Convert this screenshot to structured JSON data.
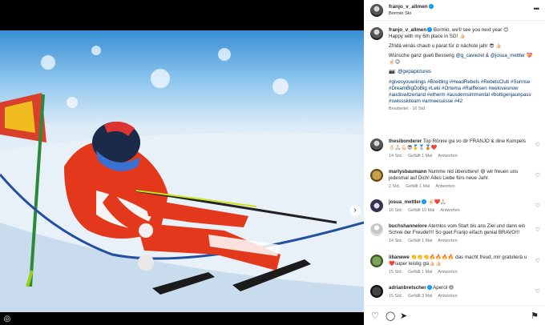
{
  "post": {
    "username": "franjo_v_allmen",
    "location": "Bormio Ski",
    "caption_lines": [
      [
        "Bormio, we'll see you next year ",
        "😊"
      ],
      [
        "Happy with my 6th place in SG! ",
        "👍🏻"
      ]
    ],
    "caption_swiss": "Zfridä winäs chaub u parat für iz nächste jahr 😎 👍🏻",
    "caption_wish_prefix": "Wünsche ganz gueti Besserig ",
    "mention_1": "@g_caviezel",
    "caption_and": " & ",
    "mention_2": "@josua_mettler",
    "caption_wish_emoji": " 💝✌🏻😉",
    "photo_credit_icon": "📷: ",
    "photo_credit": "@gepapictures",
    "hashtags": "#givesyouwiiings #Breitling #HeadRebels #RebelsClub #Sunrise #DreamBigDoBig #Leki #Ortema #Raiffeisen #welovesnow #audiswitzerland #etherm #ausdemsimmental #boltigenjaunpass #swissskiteam #armeesuisse #42",
    "edited": "Bearbeitet · 16 Std."
  },
  "comments": [
    {
      "user": "thesibonderer",
      "verified": false,
      "text": "Top Rönne gsi vo dir FRANJO & dine Kumpels 👌🏻🙏🏻💪🏻😎🥇🥈🥉❤️",
      "time": "14 Std.",
      "likes": "Gefällt 1 Mal",
      "reply": "Antworten"
    },
    {
      "user": "marlysbaumann",
      "verified": false,
      "text": "Numme nid überuttere! 😃 wir freuen uns jedesmal auf Dich! Alles Liebe fürs neue Jahr.",
      "time": "2 Std.",
      "likes": "Gefällt 1 Mal",
      "reply": "Antworten"
    },
    {
      "user": "josua_mettler",
      "verified": true,
      "text": "✌🏻❤️🙏🏻",
      "time": "16 Std.",
      "likes": "Gefällt 10 Mal",
      "reply": "Antworten"
    },
    {
      "user": "buchshannelore",
      "verified": false,
      "text": "Atemlos vom Start bis ans Ziel und dann ein Schrei der Freude!!!! So guet Franjo eifach genial BRAVO!!!",
      "time": "14 Std.",
      "likes": "Gefällt 1 Mal",
      "reply": "Antworten"
    },
    {
      "user": "lilianewe",
      "verified": false,
      "text": "👏👏👏🔥🔥🔥🔥 das macht freud..mir gratulierä u❤️super leistig gsi👍🏻👍🏻",
      "time": "15 Std.",
      "likes": "Gefällt 1 Mal",
      "reply": "Antworten"
    },
    {
      "user": "adrianbretscher",
      "verified": true,
      "text": "Aperol 😄",
      "time": "15 Std.",
      "likes": "Gefällt 3 Mal",
      "reply": "Antworten"
    }
  ],
  "icons": {
    "close": "close-icon",
    "next": "chevron-right-icon",
    "more": "more-options-icon",
    "like": "heart-icon",
    "comment": "comment-icon",
    "share": "share-icon",
    "save": "bookmark-icon"
  }
}
